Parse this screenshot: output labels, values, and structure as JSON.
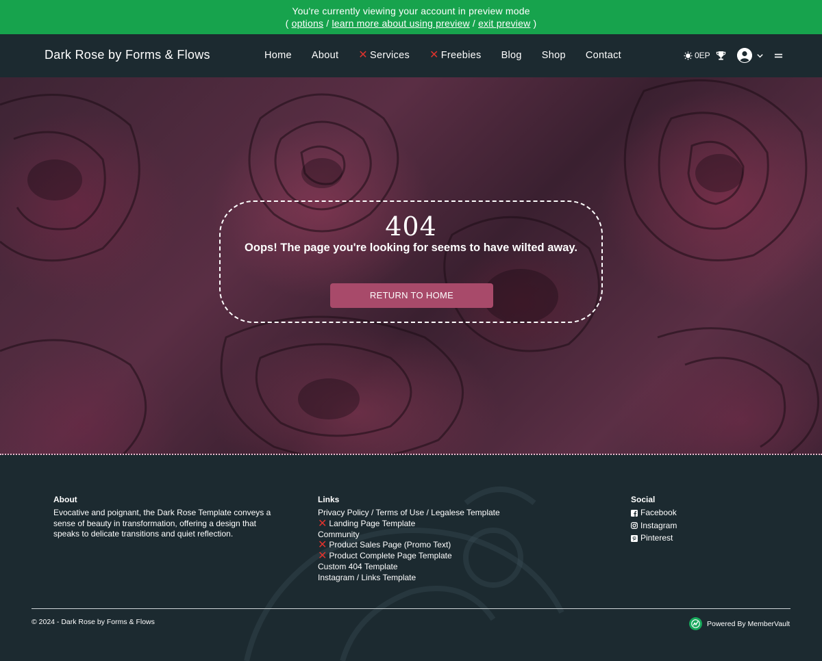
{
  "preview_banner": {
    "line1": "You're currently viewing your account in preview mode",
    "open_paren": "(",
    "options": "options",
    "sep1": "/",
    "learn_more": "learn more about using preview",
    "sep2": "/",
    "exit_preview": "exit preview",
    "close_paren": ")"
  },
  "header": {
    "brand": "Dark Rose by Forms & Flows",
    "nav": [
      {
        "label": "Home",
        "crossed": false
      },
      {
        "label": "About",
        "crossed": false
      },
      {
        "label": "Services",
        "crossed": true
      },
      {
        "label": "Freebies",
        "crossed": true
      },
      {
        "label": "Blog",
        "crossed": false
      },
      {
        "label": "Shop",
        "crossed": false
      },
      {
        "label": "Contact",
        "crossed": false
      }
    ],
    "x_mark": "✕",
    "points": "0EP"
  },
  "hero": {
    "code": "404",
    "message": "Oops! The page you're looking for seems to have wilted away.",
    "button_label": "RETURN TO HOME"
  },
  "footer": {
    "about": {
      "heading": "About",
      "text": "Evocative and poignant, the Dark Rose Template conveys a sense of beauty in transformation, offering a design that speaks to delicate transitions and quiet reflection."
    },
    "links": {
      "heading": "Links",
      "items": [
        {
          "label": "Privacy Policy / Terms of Use / Legalese Template",
          "crossed": false
        },
        {
          "label": "Landing Page Template",
          "crossed": true
        },
        {
          "label": "Community",
          "crossed": false
        },
        {
          "label": "Product Sales Page (Promo Text)",
          "crossed": true
        },
        {
          "label": "Product Complete Page Template",
          "crossed": true
        },
        {
          "label": "Custom 404 Template",
          "crossed": false
        },
        {
          "label": "Instagram / Links Template",
          "crossed": false
        }
      ]
    },
    "social": {
      "heading": "Social",
      "items": [
        "Facebook",
        "Instagram",
        "Pinterest"
      ]
    },
    "copyright": "© 2024 - Dark Rose by Forms & Flows",
    "powered_by": "Powered By MemberVault"
  },
  "colors": {
    "preview_green": "#17a34d",
    "header_bg": "#1c2a30",
    "button_rose": "#a84a6a",
    "x_red": "#e0332d"
  },
  "icons": [
    "sun-icon",
    "trophy-icon",
    "user-avatar-icon",
    "chevron-down-icon",
    "menu-icon",
    "facebook-icon",
    "instagram-icon",
    "pinterest-icon",
    "membervault-logo-icon"
  ]
}
